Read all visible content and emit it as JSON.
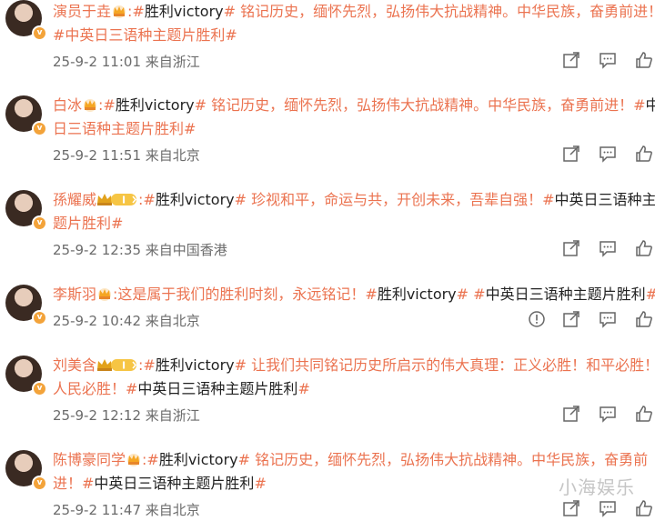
{
  "comments": [
    {
      "name": "演员于垚",
      "badge": "crown",
      "line1": ":#胜利victory# 铭记历史，缅怀先烈，弘扬伟大抗战精神。中华民族，奋勇前进！",
      "line2": "#中英日三语种主题片胜利#",
      "time": "25-9-2 11:01",
      "location": "来自浙江",
      "has_report": false
    },
    {
      "name": "白冰",
      "badge": "crown",
      "line1": ":#胜利victory# 铭记历史，缅怀先烈，弘扬伟大抗战精神。中华民族，奋勇前进！#中",
      "line2": "日三语种主题片胜利#",
      "time": "25-9-2 11:51",
      "location": "来自北京",
      "has_report": false
    },
    {
      "name": "孫耀威",
      "badge": "vip",
      "vip_level": "I",
      "line1": ":#胜利victory# 珍视和平，命运与共，开创未来，吾辈自强！#中英日三语种主",
      "line2": "题片胜利#",
      "time": "25-9-2 12:35",
      "location": "来自中国香港",
      "has_report": false
    },
    {
      "name": "李斯羽",
      "badge": "crown",
      "line1": ":这是属于我们的胜利时刻，永远铭记！#胜利victory# #中英日三语种主题片胜利#",
      "line2": "",
      "time": "25-9-2 10:42",
      "location": "来自北京",
      "has_report": true
    },
    {
      "name": "刘美含",
      "badge": "vip",
      "vip_level": "I",
      "line1": ":#胜利victory# 让我们共同铭记历史所启示的伟大真理：正义必胜！和平必胜！",
      "line2": "人民必胜！#中英日三语种主题片胜利#",
      "time": "25-9-2 12:12",
      "location": "来自浙江",
      "has_report": false
    },
    {
      "name": "陈博豪同学",
      "badge": "crown",
      "line1": ":#胜利victory# 铭记历史，缅怀先烈，弘扬伟大抗战精神。中华民族，奋勇前",
      "line2": "进！#中英日三语种主题片胜利#",
      "time": "25-9-2 11:47",
      "location": "来自北京",
      "has_report": false
    }
  ],
  "watermark": "小海娱乐",
  "colors": {
    "accent": "#eb7350",
    "meta": "#6b6b6b",
    "verified": "#f3a33a"
  },
  "icons": [
    "forward-icon",
    "comment-icon",
    "like-icon",
    "report-icon",
    "crown-icon",
    "vip-badge-icon",
    "verified-badge-icon"
  ]
}
